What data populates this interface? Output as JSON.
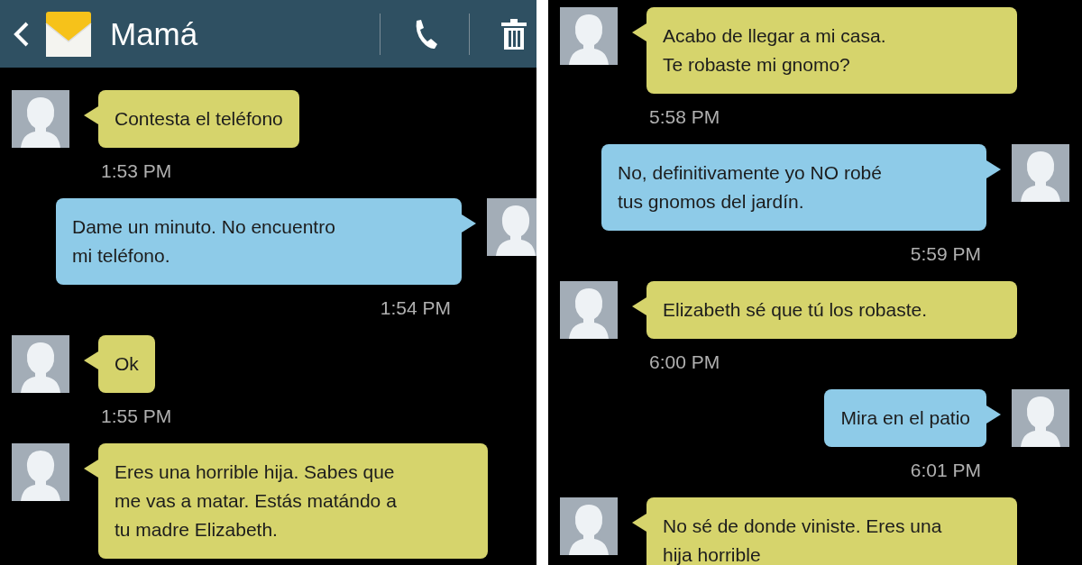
{
  "panels": [
    {
      "header": {
        "title": "Mamá"
      },
      "messages": [
        {
          "kind": "received",
          "text": "Contesta el teléfono",
          "time": "1:53 PM"
        },
        {
          "kind": "sent",
          "text": "Dame un minuto. No encuentro\nmi teléfono.",
          "time": "1:54 PM"
        },
        {
          "kind": "received",
          "text": "Ok",
          "time": "1:55 PM"
        },
        {
          "kind": "received",
          "text": "Eres una horrible hija. Sabes que\nme vas a matar. Estás matándo a\ntu madre Elizabeth."
        }
      ]
    },
    {
      "messages": [
        {
          "kind": "received",
          "text": "Acabo de llegar a mi casa.\nTe robaste mi gnomo?",
          "time": "5:58 PM"
        },
        {
          "kind": "sent",
          "text": "No, definitivamente yo NO robé\ntus gnomos del jardín.",
          "time": "5:59 PM"
        },
        {
          "kind": "received",
          "text": "Elizabeth sé que tú los robaste.",
          "time": "6:00 PM"
        },
        {
          "kind": "sent",
          "text": "Mira en el patio",
          "time": "6:01 PM"
        },
        {
          "kind": "received",
          "text": "No sé de donde viniste. Eres una\nhija horrible"
        }
      ]
    }
  ]
}
